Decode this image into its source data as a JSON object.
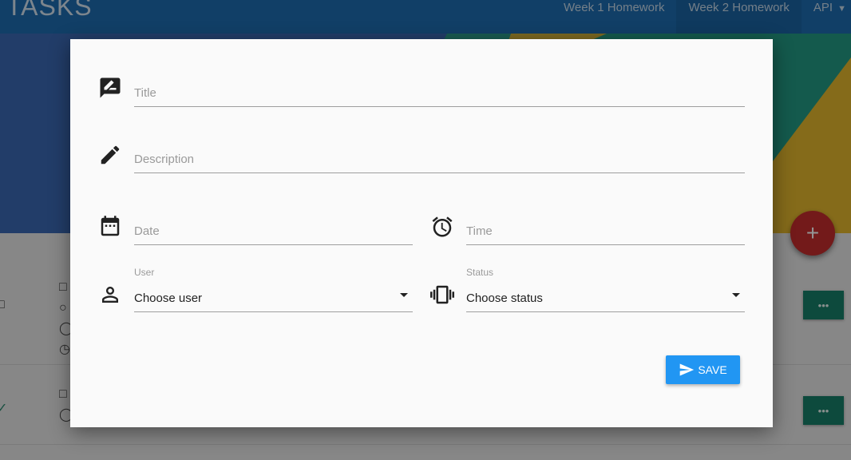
{
  "app": {
    "brand": "TASKS"
  },
  "nav": {
    "links": [
      "Week 1 Homework",
      "Week 2 Homework",
      "API"
    ],
    "active_index": 1
  },
  "fab": {
    "label": "+"
  },
  "list": {
    "more_label": "•••"
  },
  "modal": {
    "title_placeholder": "Title",
    "description_placeholder": "Description",
    "date_placeholder": "Date",
    "time_placeholder": "Time",
    "user": {
      "label": "User",
      "value": "Choose user"
    },
    "status": {
      "label": "Status",
      "value": "Choose status"
    },
    "save_label": "SAVE"
  },
  "colors": {
    "navbar": "#1e6db2",
    "accent": "#2196f3",
    "fab": "#c62d2d",
    "row_button": "#17806a"
  }
}
